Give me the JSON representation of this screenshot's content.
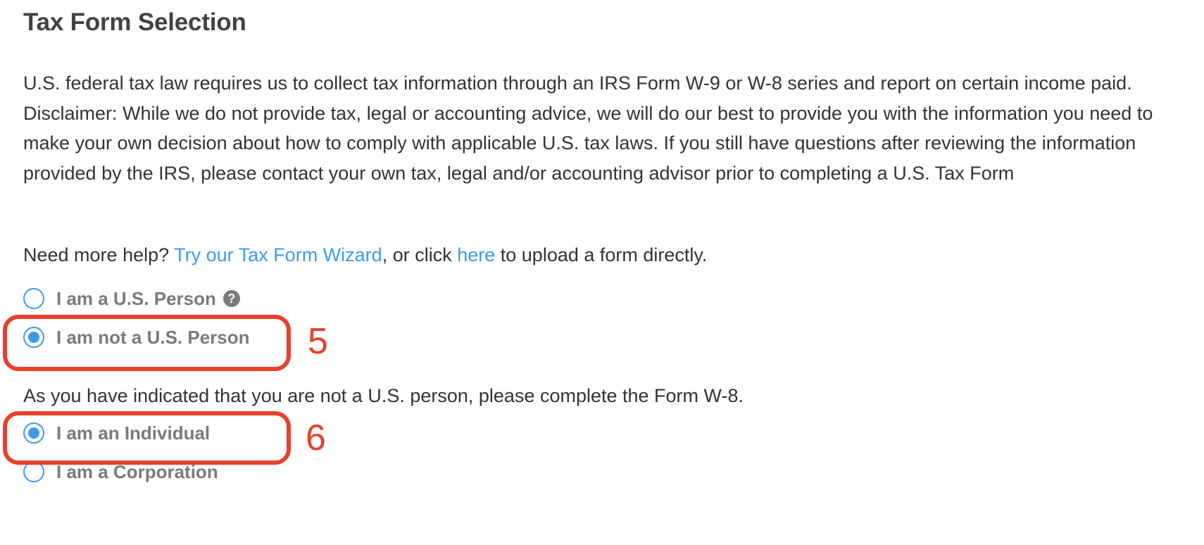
{
  "page": {
    "title": "Tax Form Selection",
    "disclaimer": "U.S. federal tax law requires us to collect tax information through an IRS Form W-9 or W-8 series and report on certain income paid. Disclaimer: While we do not provide tax, legal or accounting advice, we will do our best to provide you with the information you need to make your own decision about how to comply with applicable U.S. tax laws. If you still have questions after reviewing the information provided by the IRS, please contact your own tax, legal and/or accounting advisor prior to completing a U.S. Tax Form",
    "help": {
      "prefix": "Need more help? ",
      "wizard_link": "Try our Tax Form Wizard",
      "middle": ", or click ",
      "here_link": "here",
      "suffix": " to upload a form directly."
    },
    "person_options": [
      {
        "label": "I am a U.S. Person",
        "checked": false,
        "has_help_icon": true
      },
      {
        "label": "I am not a U.S. Person",
        "checked": true
      }
    ],
    "notice": "As you have indicated that you are not a U.S. person, please complete the Form W-8.",
    "entity_options": [
      {
        "label": "I am an Individual",
        "checked": true
      },
      {
        "label": "I am a Corporation",
        "checked": false
      }
    ],
    "help_icon_glyph": "?"
  },
  "annotations": [
    {
      "number": "5",
      "target": "I am not a U.S. Person"
    },
    {
      "number": "6",
      "target": "I am an Individual"
    }
  ],
  "colors": {
    "link": "#3d9be9",
    "radio": "#3d9be9",
    "annotation": "#e8402a",
    "label": "#7a7a7a"
  }
}
